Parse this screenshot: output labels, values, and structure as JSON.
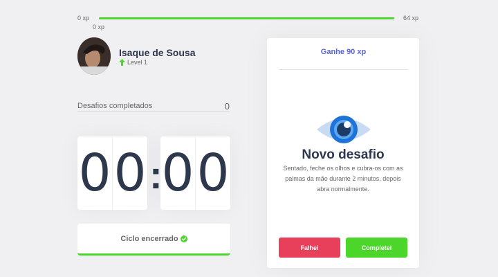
{
  "xp_bar": {
    "min_label": "0 xp",
    "max_label": "64 xp",
    "current_label": "0 xp",
    "progress_fraction": 0.998
  },
  "profile": {
    "name": "Isaque de Sousa",
    "level_label": "Level 1"
  },
  "completed_challenges": {
    "label": "Desafios completados",
    "count": "0"
  },
  "countdown": {
    "minute_left": "0",
    "minute_right": "0",
    "separator": ":",
    "second_left": "0",
    "second_right": "0"
  },
  "cycle_button": {
    "label": "Ciclo encerrado"
  },
  "challenge": {
    "reward": "Ganhe 90 xp",
    "title": "Novo desafio",
    "description": "Sentado, feche os olhos e cubra-os com as palmas da mão durante 2 minutos, depois abra normalmente.",
    "fail_label": "Falhei",
    "complete_label": "Completei",
    "icon": "eye-icon"
  },
  "colors": {
    "accent_green": "#4cd62b",
    "accent_red": "#e83f5b",
    "accent_blue": "#5965e0",
    "title_dark": "#2e384d"
  }
}
